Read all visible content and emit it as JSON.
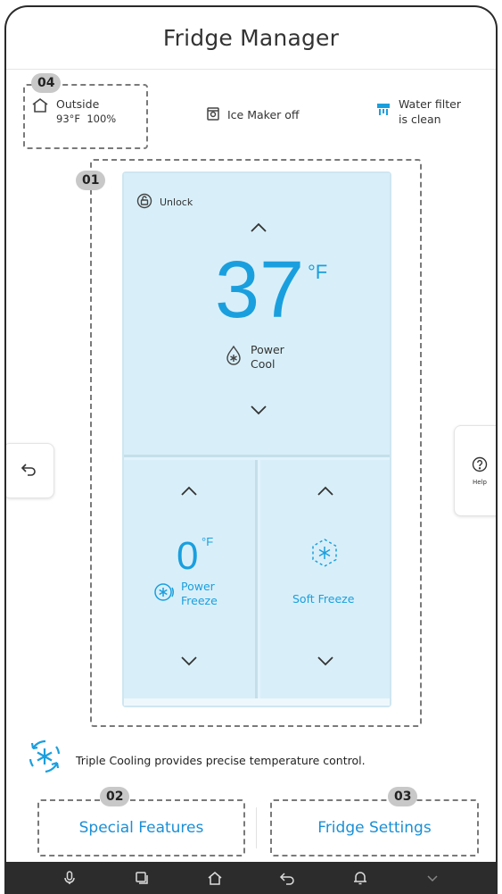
{
  "header": {
    "title": "Fridge Manager"
  },
  "callouts": {
    "c01": "01",
    "c02": "02",
    "c03": "03",
    "c04": "04"
  },
  "status": {
    "outside_label": "Outside",
    "outside_temp": "93°F",
    "outside_humidity": "100%",
    "ice_maker": "Ice Maker off",
    "water_filter_line1": "Water filter",
    "water_filter_line2": "is clean"
  },
  "fridge": {
    "lock_label": "Unlock",
    "fridge_temp": "37",
    "fridge_unit": "°F",
    "fridge_mode_line1": "Power",
    "fridge_mode_line2": "Cool",
    "freezer_temp": "0",
    "freezer_unit": "°F",
    "freezer_mode_line1": "Power",
    "freezer_mode_line2": "Freeze",
    "right_mode": "Soft Freeze"
  },
  "side": {
    "help_label": "Help"
  },
  "info": {
    "text": "Triple Cooling provides precise temperature control."
  },
  "buttons": {
    "special_features": "Special Features",
    "fridge_settings": "Fridge Settings"
  },
  "icons": {
    "home": "home-icon",
    "ice": "ice-maker-icon",
    "filter": "water-filter-icon",
    "lock": "lock-icon",
    "help": "help-icon",
    "back": "back-icon",
    "mic": "microphone-icon",
    "recent": "recent-apps-icon",
    "nav_home": "home-nav-icon",
    "nav_back": "back-nav-icon",
    "bell": "notification-icon",
    "collapse": "chevron-down-icon"
  },
  "colors": {
    "accent": "#1a9fde",
    "fridge_bg": "#d8eff9",
    "navbar": "#2c2c2c"
  }
}
